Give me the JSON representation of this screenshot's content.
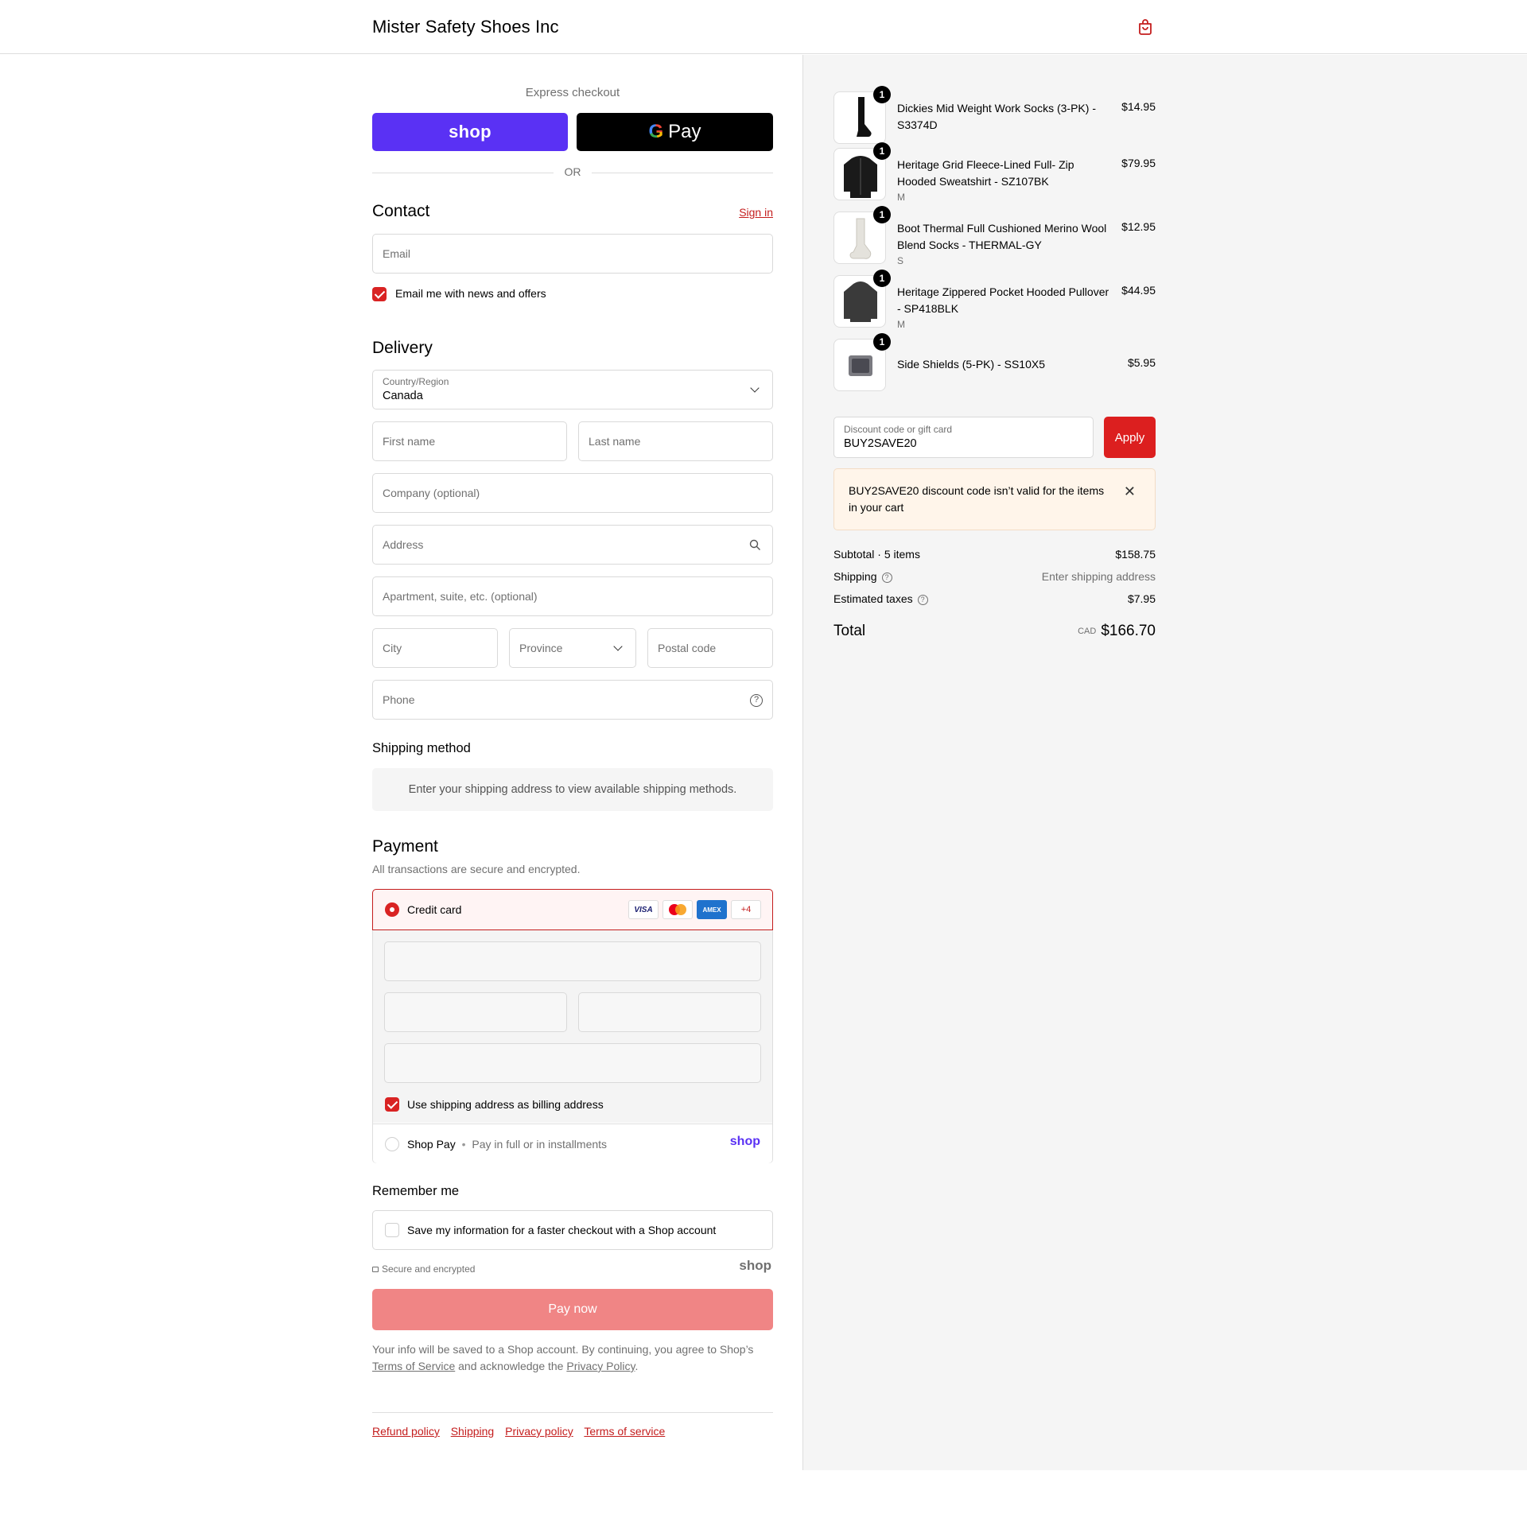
{
  "header": {
    "brand": "Mister Safety Shoes Inc",
    "cart_icon": "shopping-bag-icon"
  },
  "express": {
    "title": "Express checkout",
    "shop_label": "shop",
    "gpay_g": "G",
    "gpay_label": "Pay",
    "or_label": "OR"
  },
  "contact": {
    "title": "Contact",
    "sign_in": "Sign in",
    "email_placeholder": "Email",
    "news_label": "Email me with news and offers",
    "news_checked": true
  },
  "delivery": {
    "title": "Delivery",
    "country_label": "Country/Region",
    "country_value": "Canada",
    "first_name": "First name",
    "last_name": "Last name",
    "company": "Company (optional)",
    "address": "Address",
    "apartment": "Apartment, suite, etc. (optional)",
    "city": "City",
    "province": "Province",
    "postal": "Postal code",
    "phone": "Phone"
  },
  "shipping_method": {
    "title": "Shipping method",
    "message": "Enter your shipping address to view available shipping methods."
  },
  "payment": {
    "title": "Payment",
    "subtitle": "All transactions are secure and encrypted.",
    "credit_card_label": "Credit card",
    "card_logos": [
      "VISA",
      "AMEX",
      "+4"
    ],
    "billing_label": "Use shipping address as billing address",
    "shop_pay_label": "Shop Pay",
    "shop_pay_sub": "Pay in full or in installments",
    "shop_pay_logo": "shop"
  },
  "remember": {
    "title": "Remember me",
    "save_label": "Save my information for a faster checkout with a Shop account",
    "secure_label": "Secure and encrypted",
    "shop_logo": "shop"
  },
  "pay_now": "Pay now",
  "legal": {
    "text1": "Your info will be saved to a Shop account. By continuing, you agree to Shop’s",
    "terms": "Terms of Service",
    "text2": "and acknowledge the",
    "privacy": "Privacy Policy",
    "end": "."
  },
  "footer_links": [
    "Refund policy",
    "Shipping",
    "Privacy policy",
    "Terms of service"
  ],
  "cart": {
    "items": [
      {
        "name": "Dickies Mid Weight Work Socks (3-PK) - S3374D",
        "variant": "",
        "price": "$14.95",
        "qty": "1"
      },
      {
        "name": "Heritage Grid Fleece-Lined Full- Zip Hooded Sweatshirt - SZ107BK",
        "variant": "M",
        "price": "$79.95",
        "qty": "1"
      },
      {
        "name": "Boot Thermal Full Cushioned Merino Wool Blend Socks - THERMAL-GY",
        "variant": "S",
        "price": "$12.95",
        "qty": "1"
      },
      {
        "name": "Heritage Zippered Pocket Hooded Pullover - SP418BLK",
        "variant": "M",
        "price": "$44.95",
        "qty": "1"
      },
      {
        "name": "Side Shields (5-PK) - SS10X5",
        "variant": "",
        "price": "$5.95",
        "qty": "1"
      }
    ],
    "discount_label": "Discount code or gift card",
    "discount_value": "BUY2SAVE20",
    "apply": "Apply",
    "warning": "BUY2SAVE20 discount code isn’t valid for the items in your cart",
    "subtotal_label": "Subtotal · 5 items",
    "subtotal": "$158.75",
    "shipping_label": "Shipping",
    "shipping_value": "Enter shipping address",
    "taxes_label": "Estimated taxes",
    "taxes": "$7.95",
    "total_label": "Total",
    "currency": "CAD",
    "total": "$166.70"
  },
  "colors": {
    "accent": "#d92323",
    "shop_purple": "#5a31f4",
    "pay_disabled": "#f08585"
  }
}
